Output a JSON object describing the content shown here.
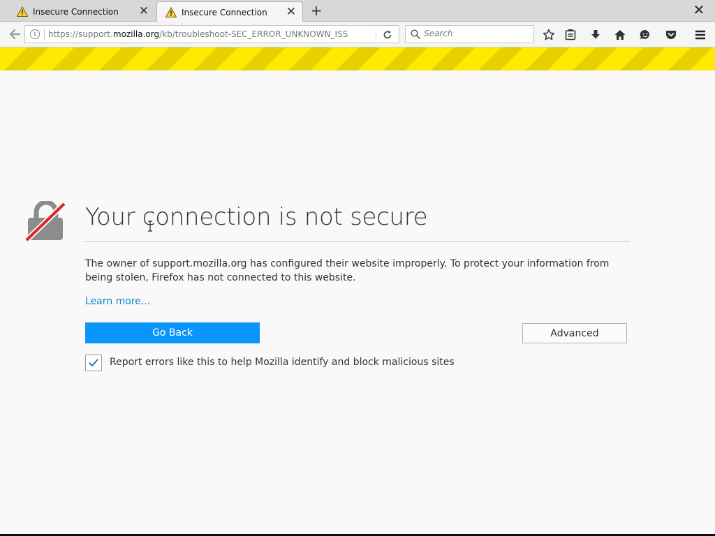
{
  "tabs": [
    {
      "title": "Insecure Connection",
      "icon": "warning-icon",
      "active": false
    },
    {
      "title": "Insecure Connection",
      "icon": "warning-icon",
      "active": true
    }
  ],
  "new_tab_glyph": "+",
  "close_glyph": "✕",
  "nav": {
    "url_prefix": "https://support.",
    "url_host": "mozilla.org",
    "url_path": "/kb/troubleshoot-SEC_ERROR_UNKNOWN_ISS",
    "search_placeholder": "Search",
    "toolbar_icons": [
      "star-icon",
      "reading-list-icon",
      "download-icon",
      "home-icon",
      "smiley-icon",
      "pocket-icon",
      "menu-icon"
    ]
  },
  "error": {
    "title": "Your connection is not secure",
    "description": "The owner of support.mozilla.org has configured their website improperly. To protect your information from being stolen, Firefox has not connected to this website.",
    "learn_more": "Learn more...",
    "go_back": "Go Back",
    "advanced": "Advanced",
    "report_checked": true,
    "report_label": "Report errors like this to help Mozilla identify and block malicious sites"
  },
  "colors": {
    "primary_button": "#0996f8",
    "link": "#0a84c8",
    "warning_stripe": "#ffe900",
    "lock_slash": "#d7262e"
  }
}
